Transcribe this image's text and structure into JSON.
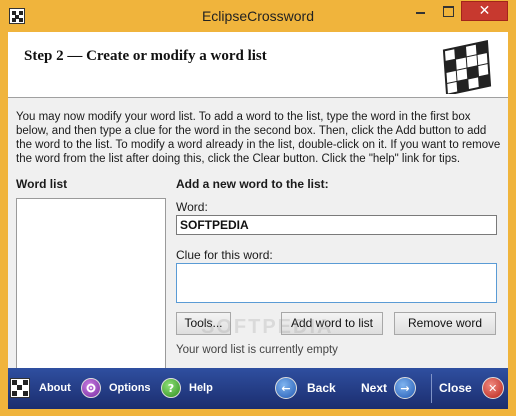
{
  "window": {
    "title": "EclipseCrossword",
    "close_glyph": "✕"
  },
  "header": {
    "step_title": "Step 2 — Create or modify a word list"
  },
  "instructions": "You may now modify your word list.  To add a word to the list, type the word in the first box below, and then type a clue for the word in the second box.  Then, click the Add button to add the word to the list.  To modify a word already in the list, double-click on it.  If you want to remove the word from the list after doing this, click the Clear button.  Click the \"help\" link for tips.",
  "wordlist": {
    "label": "Word list",
    "items": []
  },
  "add_form": {
    "heading": "Add a new word to the list:",
    "word_label": "Word:",
    "word_value": "SOFTPEDIA",
    "clue_label": "Clue for this word:",
    "clue_value": "",
    "tools_button": "Tools...",
    "add_button": "Add word to list",
    "remove_button": "Remove word",
    "status": "Your word list is currently empty"
  },
  "watermark": "SOFTPEDIA",
  "bottom_nav": {
    "about": "About",
    "options": "Options",
    "help": "Help",
    "back": "Back",
    "next": "Next",
    "close": "Close",
    "help_glyph": "?",
    "back_glyph": "←",
    "next_glyph": "→",
    "close_glyph": "✕"
  },
  "colors": {
    "title_bar": "#f0b43c",
    "bottom_bar": "#2f4fa0",
    "close_button": "#c7392f"
  }
}
